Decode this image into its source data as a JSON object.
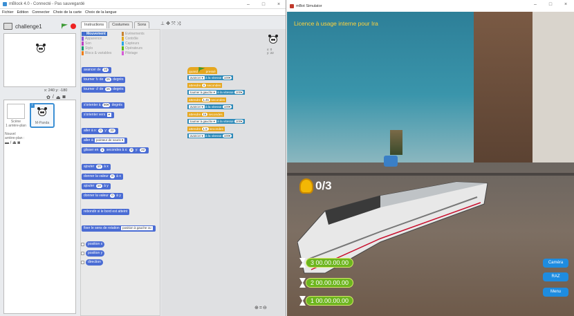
{
  "left_window": {
    "title": "mBlock 4.0 - Connecté - Pas sauvegardé",
    "controls": [
      "–",
      "□",
      "×"
    ],
    "menu": [
      "Fichier",
      "Edition",
      "Connecter",
      "Choix de la carte",
      "Choix de la langue"
    ],
    "sprite_name": "challenge1",
    "coords": "x: 240  y: -180",
    "tools_icons": [
      "flower-icon",
      "brush-icon",
      "upload-icon",
      "camera-icon"
    ],
    "stage_label": "Scène",
    "stage_sub": "1 arrière-plan",
    "new_backdrop": "Nouvel arrière-plan :",
    "sprite_label": "M-Panda",
    "sprite_badge": "i",
    "tabs": [
      "Instructions",
      "Costumes",
      "Sons"
    ],
    "categories": [
      {
        "label": "Mouvement",
        "color": "#4a6cd4"
      },
      {
        "label": "Apparence",
        "color": "#8a55d7"
      },
      {
        "label": "Son",
        "color": "#bb42c3"
      },
      {
        "label": "Stylo",
        "color": "#0e9a6c"
      },
      {
        "label": "Blocs & variables",
        "color": "#ee7d16"
      },
      {
        "label": "Evènements",
        "color": "#c88330"
      },
      {
        "label": "Contrôle",
        "color": "#e1a91a"
      },
      {
        "label": "Capteurs",
        "color": "#2ca5e2"
      },
      {
        "label": "Opérateurs",
        "color": "#5cb712"
      },
      {
        "label": "Pilotage",
        "color": "#d65cd6"
      }
    ],
    "palette_blocks": [
      {
        "pre": "avancer de",
        "v": "10"
      },
      {
        "pre": "tourner ↻ de",
        "v": "15",
        "post": "degrés"
      },
      {
        "pre": "tourner ↺ de",
        "v": "15",
        "post": "degrés"
      },
      {
        "pre": "s'orienter à",
        "v": "90▾",
        "post": "degrés"
      },
      {
        "pre": "s'orienter vers",
        "dd": "▾"
      },
      {
        "pre": "aller à x:",
        "v": "0",
        "mid": "y:",
        "v2": "22"
      },
      {
        "pre": "aller à",
        "dd": "pointeur de souris ▾"
      },
      {
        "pre": "glisser en",
        "v": "1",
        "mid": "secondes à x:",
        "v2": "0",
        "mid2": "y:",
        "v3": "22"
      },
      {
        "pre": "ajouter",
        "v": "10",
        "post": "à x"
      },
      {
        "pre": "donner la valeur",
        "v": "0",
        "post": "à x"
      },
      {
        "pre": "ajouter",
        "v": "10",
        "post": "à y"
      },
      {
        "pre": "donner la valeur",
        "v": "0",
        "post": "à y"
      },
      {
        "pre": "rebondir si le bord est atteint"
      },
      {
        "pre": "fixer le sens de rotation",
        "dd": "position à gauche ou"
      },
      {
        "pre": "position x"
      },
      {
        "pre": "position y"
      },
      {
        "pre": "direction"
      }
    ],
    "script": [
      {
        "kind": "hat",
        "pre": "quand",
        "post": "pressé"
      },
      {
        "kind": "blue",
        "dd": "avancer ▾",
        "pre": "à la vitesse",
        "v": "100▾"
      },
      {
        "kind": "orange",
        "pre": "attendre",
        "v": "4",
        "post": "secondes"
      },
      {
        "kind": "blue",
        "dd": "tourner à gauche ▾",
        "pre": "à la vitesse",
        "v": "100▾"
      },
      {
        "kind": "orange",
        "pre": "attendre",
        "v": "1.45",
        "post": "secondes"
      },
      {
        "kind": "blue",
        "dd": "avancer ▾",
        "pre": "à la vitesse",
        "v": "100▾"
      },
      {
        "kind": "orange",
        "pre": "attendre",
        "v": "15",
        "post": "secondes"
      },
      {
        "kind": "blue",
        "dd": "tourner à gauche ▾",
        "pre": "à la vitesse",
        "v": "100▾"
      },
      {
        "kind": "orange",
        "pre": "attendre",
        "v": "1.9",
        "post": "secondes"
      },
      {
        "kind": "blue",
        "dd": "avancer ▾",
        "pre": "à la vitesse",
        "v": "100▾"
      }
    ],
    "mini_coords": "x: 0\ny: 22",
    "zoom_icons": [
      "zoom-in-icon",
      "zoom-reset-icon",
      "zoom-out-icon"
    ]
  },
  "right_window": {
    "title": "mBot Simulator",
    "controls": [
      "–",
      "□",
      "×"
    ],
    "licence": "Licence à usage interne pour Ira",
    "score": "0/3",
    "timers": [
      "3 00.00.00.00",
      "2 00.00.00.00",
      "1 00.00.00.00"
    ],
    "buttons": [
      "Caméra",
      "RAZ",
      "Menu"
    ]
  }
}
